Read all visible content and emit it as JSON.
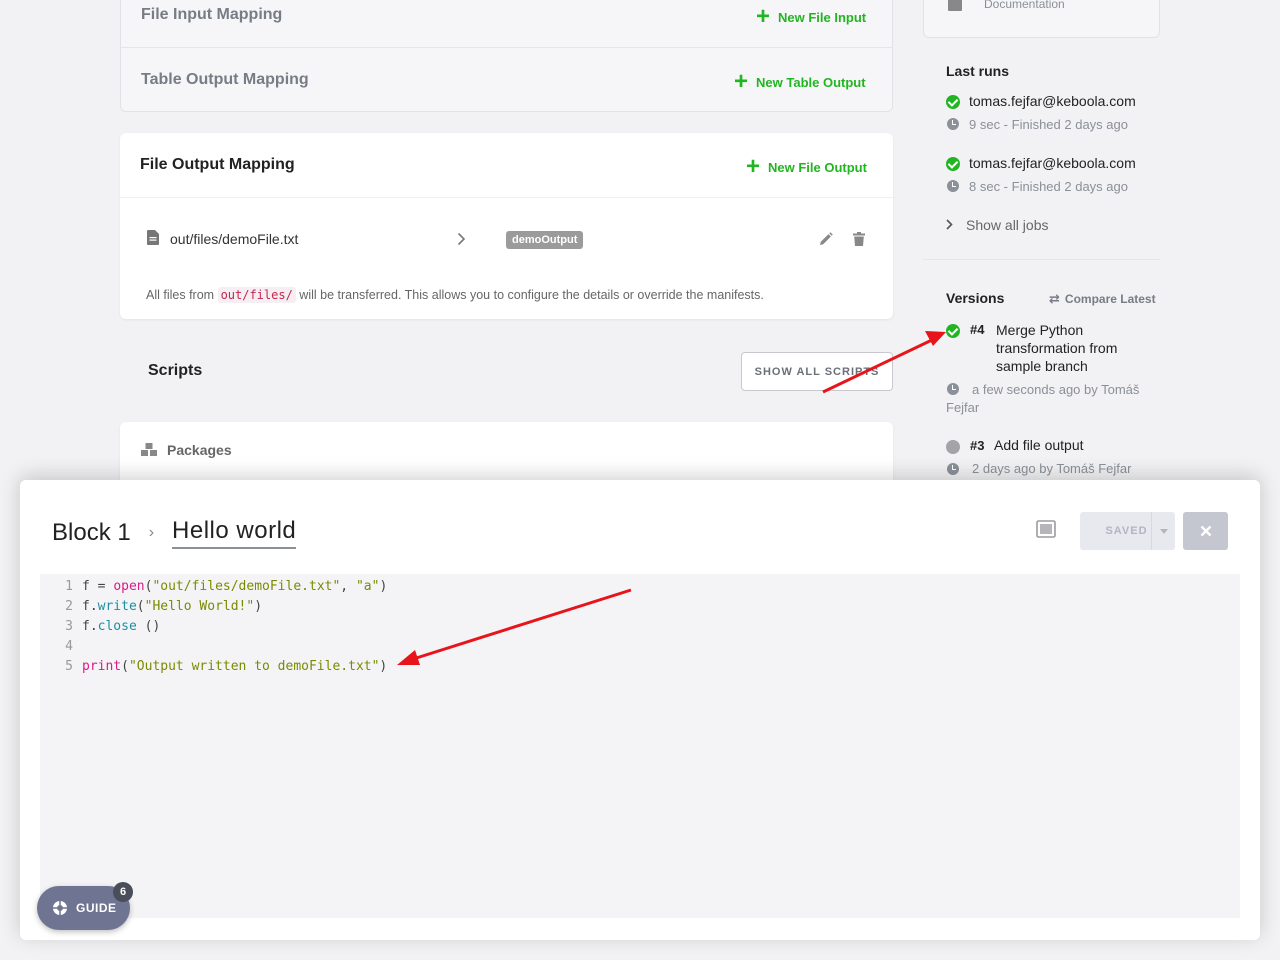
{
  "input_mapping": {
    "file_input_title": "File Input Mapping",
    "new_file_input": "New File Input",
    "table_output_title": "Table Output Mapping",
    "new_table_output": "New Table Output"
  },
  "file_output": {
    "title": "File Output Mapping",
    "new_file_output": "New File Output",
    "source": "out/files/demoFile.txt",
    "tag": "demoOutput",
    "note_before": "All files from",
    "note_code": "out/files/",
    "note_after": "will be transferred. This allows you to configure the details or override the manifests."
  },
  "scripts": {
    "title": "Scripts",
    "show_all": "SHOW ALL SCRIPTS"
  },
  "packages": {
    "title": "Packages"
  },
  "sidebar": {
    "documentation": "Documentation",
    "last_runs_title": "Last runs",
    "runs": [
      {
        "user": "tomas.fejfar@keboola.com",
        "info": "9 sec - Finished 2 days ago"
      },
      {
        "user": "tomas.fejfar@keboola.com",
        "info": "8 sec - Finished 2 days ago"
      }
    ],
    "show_all_jobs": "Show all jobs",
    "versions_title": "Versions",
    "compare_latest": "Compare Latest",
    "versions": [
      {
        "num": "#4",
        "desc_l1": "Merge Python",
        "desc_l2": "transformation from",
        "desc_l3": "sample branch",
        "info_l1": "a few seconds ago by Tomáš",
        "info_l2": "Fejfar",
        "status": "current"
      },
      {
        "num": "#3",
        "desc_l1": "Add file output",
        "info_l1": "2 days ago by Tomáš Fejfar",
        "status": "previous"
      }
    ]
  },
  "modal": {
    "breadcrumb_parent": "Block 1",
    "breadcrumb_current": "Hello world",
    "saved_label": "SAVED",
    "code_lines": [
      {
        "n": "1",
        "parts": [
          [
            "plain",
            "f = "
          ],
          [
            "kw",
            "open"
          ],
          [
            "plain",
            "("
          ],
          [
            "str",
            "\"out/files/demoFile.txt\""
          ],
          [
            "plain",
            ", "
          ],
          [
            "str",
            "\"a\""
          ],
          [
            "plain",
            ")"
          ]
        ]
      },
      {
        "n": "2",
        "parts": [
          [
            "plain",
            "f."
          ],
          [
            "mth",
            "write"
          ],
          [
            "plain",
            "("
          ],
          [
            "str",
            "\"Hello World!\""
          ],
          [
            "plain",
            ")"
          ]
        ]
      },
      {
        "n": "3",
        "parts": [
          [
            "plain",
            "f."
          ],
          [
            "mth",
            "close"
          ],
          [
            "plain",
            " ()"
          ]
        ]
      },
      {
        "n": "4",
        "parts": []
      },
      {
        "n": "5",
        "parts": [
          [
            "kw",
            "print"
          ],
          [
            "plain",
            "("
          ],
          [
            "str",
            "\"Output written to demoFile.txt\""
          ],
          [
            "plain",
            ")"
          ]
        ]
      }
    ]
  },
  "guide": {
    "label": "GUIDE",
    "count": "6"
  },
  "colors": {
    "accent_green": "#22b522",
    "annotation_red": "#e8141b"
  }
}
